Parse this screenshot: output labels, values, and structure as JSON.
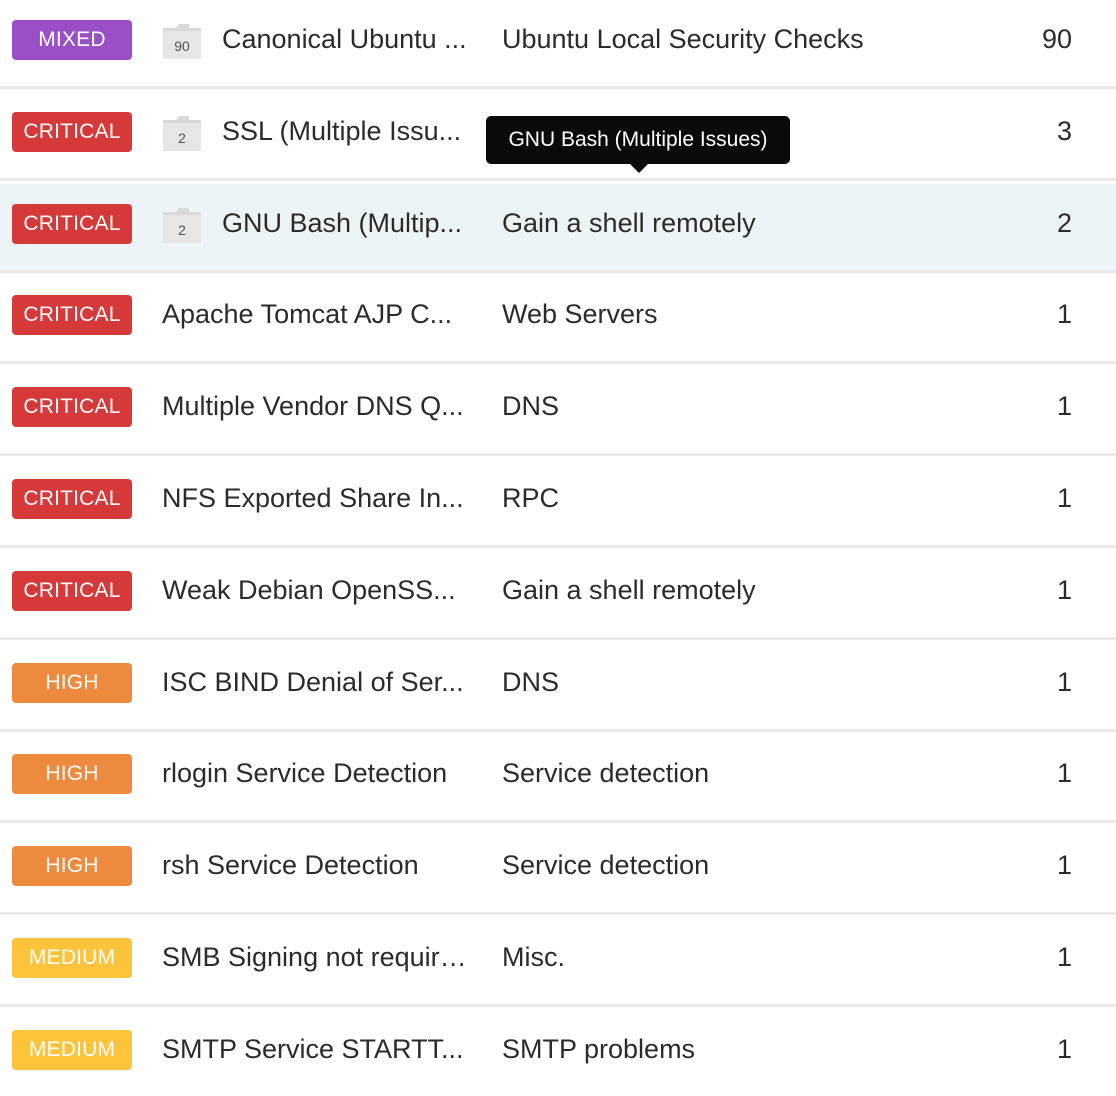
{
  "rows": [
    {
      "severity": "MIXED",
      "sev_class": "mixed",
      "folder_count": "90",
      "name": "Canonical Ubuntu ...",
      "family": "Ubuntu Local Security Checks",
      "count": "90"
    },
    {
      "severity": "CRITICAL",
      "sev_class": "critical",
      "folder_count": "2",
      "name": "SSL (Multiple Issu...",
      "family": "",
      "count": "3"
    },
    {
      "severity": "CRITICAL",
      "sev_class": "critical",
      "folder_count": "2",
      "name": "GNU Bash (Multip...",
      "family": "Gain a shell remotely",
      "count": "2",
      "hovered": true
    },
    {
      "severity": "CRITICAL",
      "sev_class": "critical",
      "folder_count": null,
      "name": "Apache Tomcat AJP C...",
      "family": "Web Servers",
      "count": "1"
    },
    {
      "severity": "CRITICAL",
      "sev_class": "critical",
      "folder_count": null,
      "name": "Multiple Vendor DNS Q...",
      "family": "DNS",
      "count": "1"
    },
    {
      "severity": "CRITICAL",
      "sev_class": "critical",
      "folder_count": null,
      "name": "NFS Exported Share In...",
      "family": "RPC",
      "count": "1"
    },
    {
      "severity": "CRITICAL",
      "sev_class": "critical",
      "folder_count": null,
      "name": "Weak Debian OpenSS...",
      "family": "Gain a shell remotely",
      "count": "1"
    },
    {
      "severity": "HIGH",
      "sev_class": "high",
      "folder_count": null,
      "name": "ISC BIND Denial of Ser...",
      "family": "DNS",
      "count": "1"
    },
    {
      "severity": "HIGH",
      "sev_class": "high",
      "folder_count": null,
      "name": "rlogin Service Detection",
      "family": "Service detection",
      "count": "1"
    },
    {
      "severity": "HIGH",
      "sev_class": "high",
      "folder_count": null,
      "name": "rsh Service Detection",
      "family": "Service detection",
      "count": "1"
    },
    {
      "severity": "MEDIUM",
      "sev_class": "medium",
      "folder_count": null,
      "name": "SMB Signing not required",
      "family": "Misc.",
      "count": "1"
    },
    {
      "severity": "MEDIUM",
      "sev_class": "medium",
      "folder_count": null,
      "name": "SMTP Service STARTT...",
      "family": "SMTP problems",
      "count": "1"
    }
  ],
  "tooltip": {
    "text": "GNU Bash (Multiple Issues)"
  },
  "colors": {
    "mixed": "#9a4fc7",
    "critical": "#d63939",
    "high": "#ee8a3e",
    "medium": "#fcc33b",
    "hover_row": "#edf4f8"
  },
  "icons": {
    "folder": "folder-icon"
  }
}
